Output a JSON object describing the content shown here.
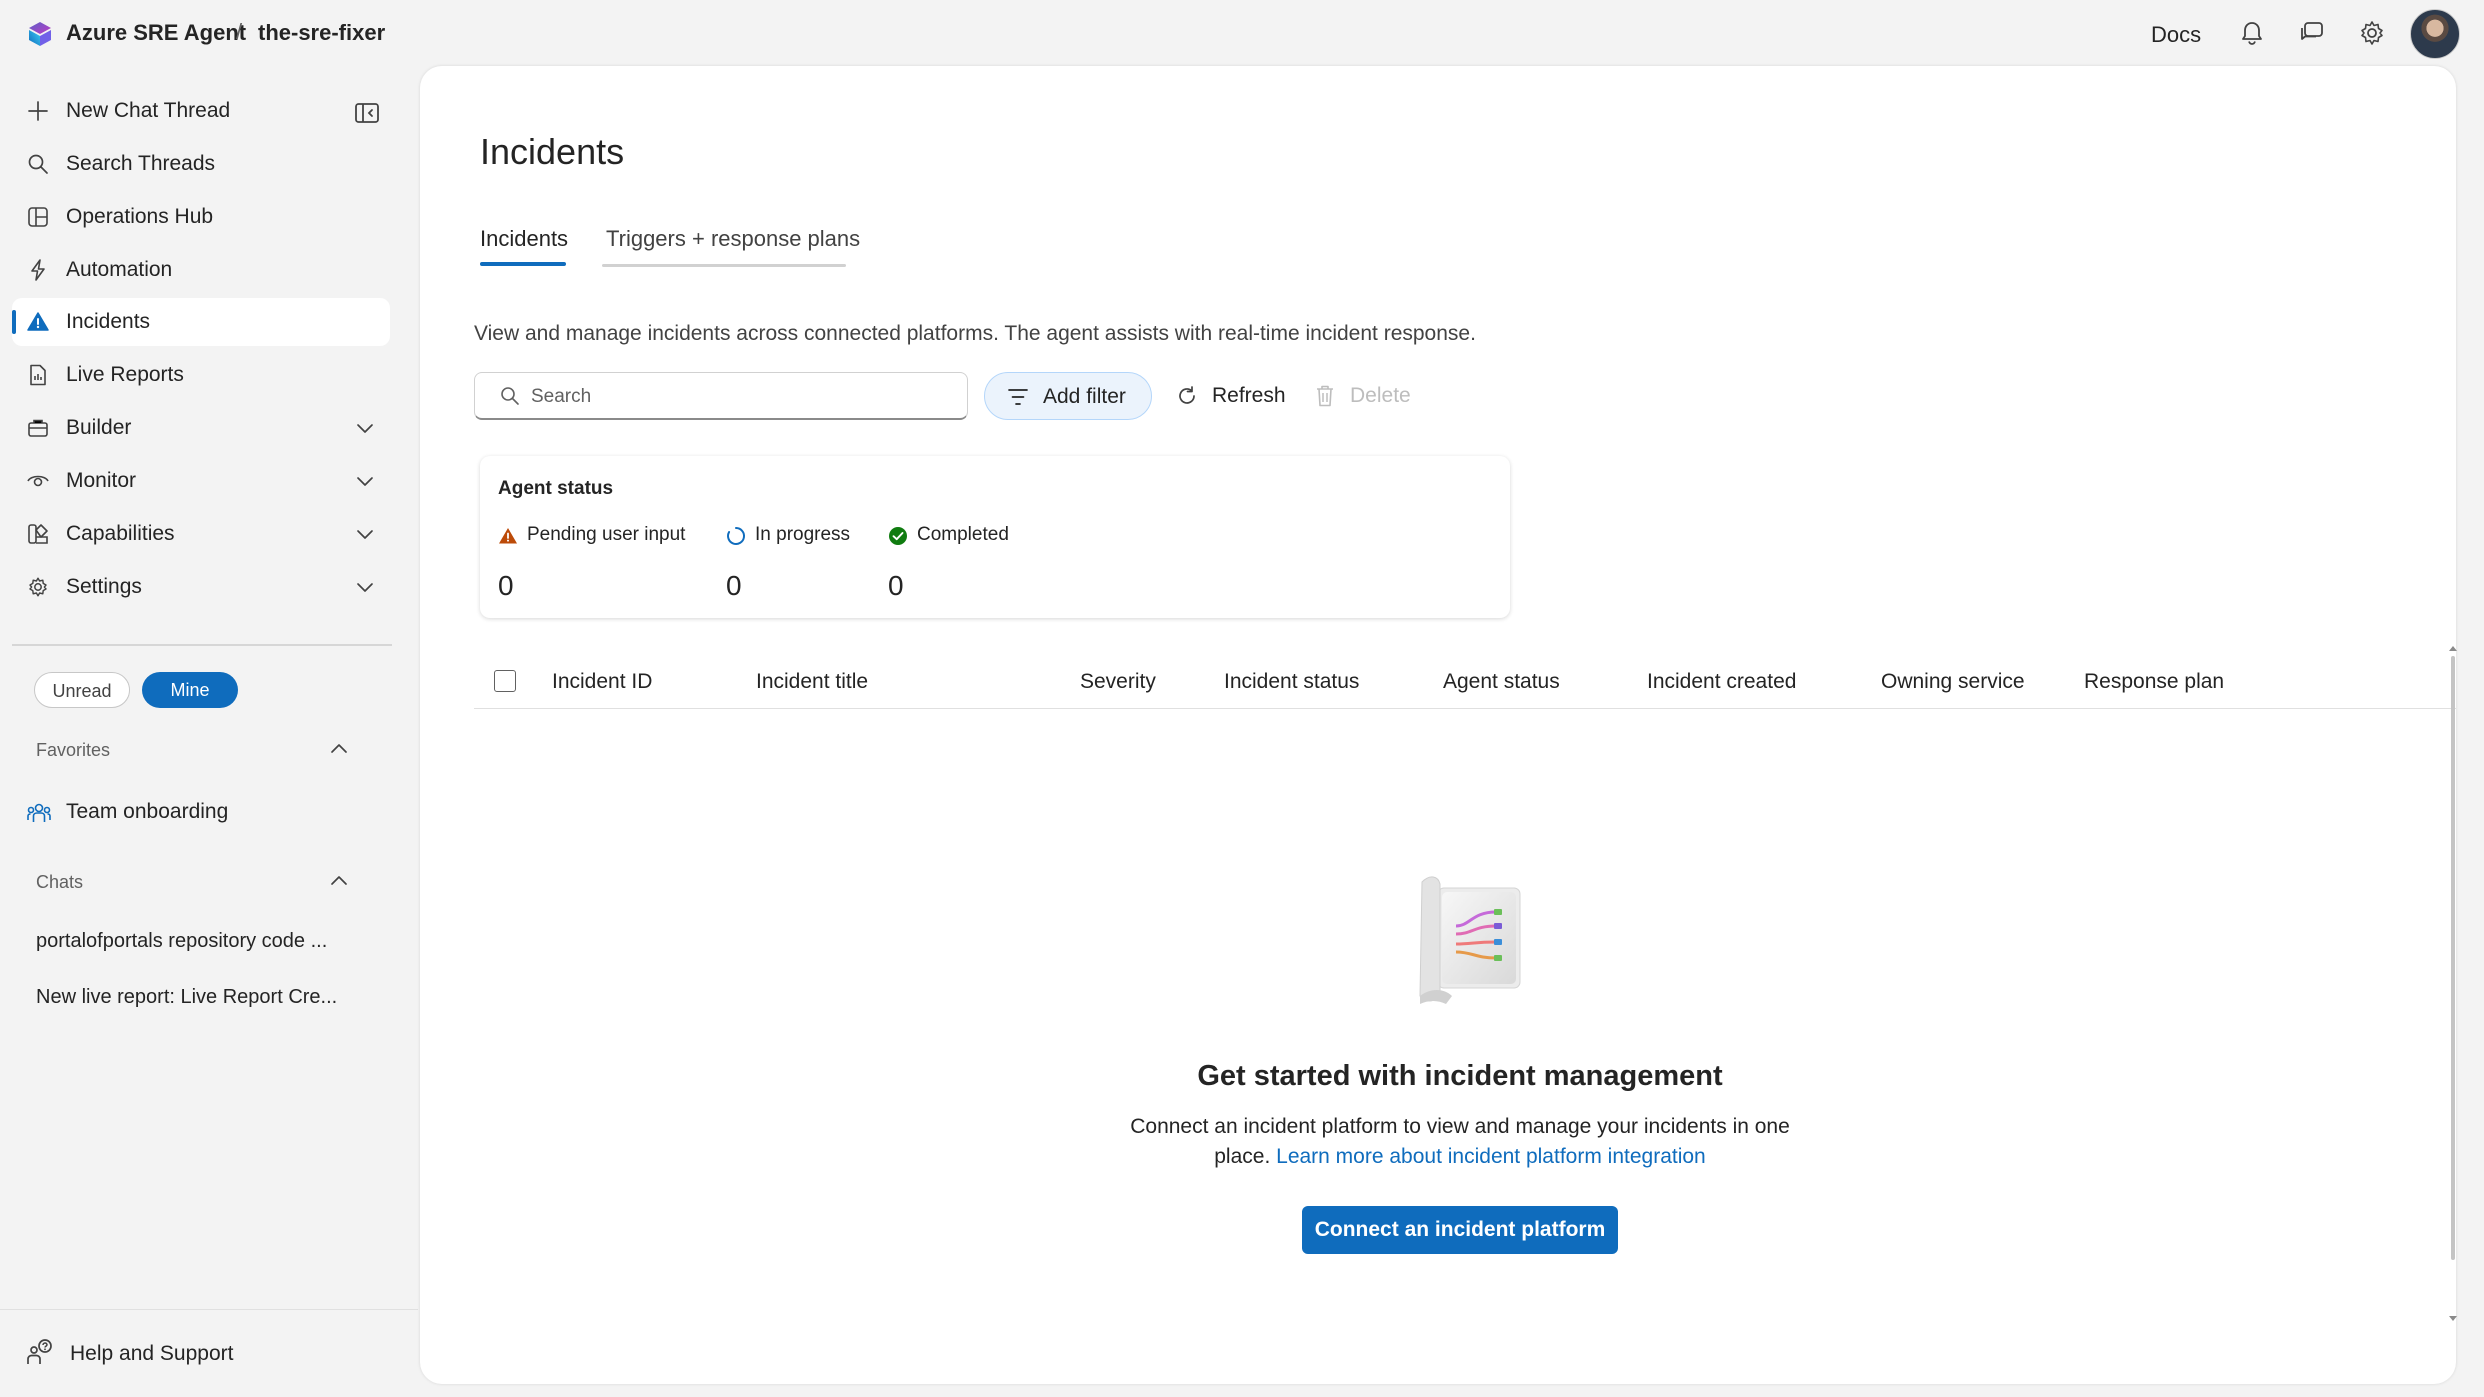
{
  "header": {
    "app_name": "Azure SRE Agent",
    "separator": "/",
    "agent_name": "the-sre-fixer",
    "docs_label": "Docs",
    "icons": [
      "bell-icon",
      "feedback-icon",
      "gear-icon"
    ]
  },
  "sidebar": {
    "items": [
      {
        "label": "New Chat Thread",
        "icon": "plus-icon"
      },
      {
        "label": "Search Threads",
        "icon": "search-icon"
      },
      {
        "label": "Operations Hub",
        "icon": "grid-icon"
      },
      {
        "label": "Automation",
        "icon": "lightning-icon"
      },
      {
        "label": "Incidents",
        "icon": "warning-icon",
        "active": true
      },
      {
        "label": "Live Reports",
        "icon": "report-icon"
      },
      {
        "label": "Builder",
        "icon": "toolbox-icon",
        "expandable": true
      },
      {
        "label": "Monitor",
        "icon": "eye-icon",
        "expandable": true
      },
      {
        "label": "Capabilities",
        "icon": "capabilities-icon",
        "expandable": true
      },
      {
        "label": "Settings",
        "icon": "gear-icon",
        "expandable": true
      }
    ],
    "filters": {
      "unread": "Unread",
      "mine": "Mine"
    },
    "favorites": {
      "heading": "Favorites",
      "items": [
        "Team onboarding"
      ]
    },
    "chats": {
      "heading": "Chats",
      "items": [
        "portalofportals repository code ...",
        "New live report: Live Report Cre..."
      ]
    },
    "help_label": "Help and Support"
  },
  "main": {
    "title": "Incidents",
    "tabs": [
      {
        "label": "Incidents",
        "active": true
      },
      {
        "label": "Triggers + response plans",
        "active": false
      }
    ],
    "description": "View and manage incidents across connected platforms. The agent assists with real-time incident response.",
    "toolbar": {
      "search_placeholder": "Search",
      "add_filter": "Add filter",
      "refresh": "Refresh",
      "delete": "Delete"
    },
    "agent_status": {
      "title": "Agent status",
      "stats": [
        {
          "label": "Pending user input",
          "value": "0",
          "icon": "warning-icon",
          "color": "#bc4b09"
        },
        {
          "label": "In progress",
          "value": "0",
          "icon": "spinner-icon",
          "color": "#0f6cbd"
        },
        {
          "label": "Completed",
          "value": "0",
          "icon": "check-circle-icon",
          "color": "#107c10"
        }
      ]
    },
    "table": {
      "columns": [
        "Incident ID",
        "Incident title",
        "Severity",
        "Incident status",
        "Agent status",
        "Incident created",
        "Owning service",
        "Response plan"
      ]
    },
    "empty_state": {
      "title": "Get started with incident management",
      "description": "Connect an incident platform to view and manage your incidents in one place.",
      "link": "Learn more about incident platform integration",
      "button": "Connect an incident platform"
    }
  },
  "colors": {
    "accent": "#0f6cbd",
    "background": "#f3f3f3",
    "panel": "#ffffff"
  }
}
